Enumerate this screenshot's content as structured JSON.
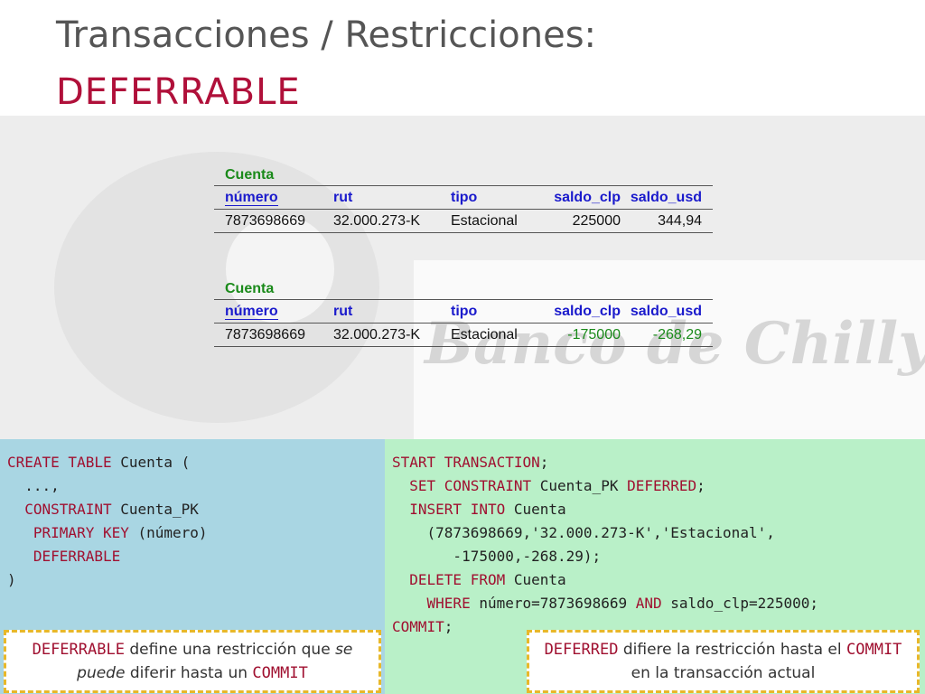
{
  "slide": {
    "title": "Transacciones / Restricciones:",
    "subtitle": "DEFERRABLE"
  },
  "photo": {
    "watermark": "Banco de Chilly"
  },
  "tables": [
    {
      "caption": "Cuenta",
      "headers": [
        "número",
        "rut",
        "tipo",
        "saldo_clp",
        "saldo_usd"
      ],
      "row": [
        "7873698669",
        "32.000.273-K",
        "Estacional",
        "225000",
        "344,94"
      ]
    },
    {
      "caption": "Cuenta",
      "headers": [
        "número",
        "rut",
        "tipo",
        "saldo_clp",
        "saldo_usd"
      ],
      "row": [
        "7873698669",
        "32.000.273-K",
        "Estacional",
        "-175000",
        "-268,29"
      ]
    }
  ],
  "code_left": {
    "l1_kw": "CREATE TABLE",
    "l1_txt": " Cuenta (",
    "l2_txt": "  ...,",
    "l3_kw": "  CONSTRAINT",
    "l3_txt": " Cuenta_PK",
    "l4_kw": "   PRIMARY KEY",
    "l4_txt": " (número)",
    "l5_kw": "   DEFERRABLE",
    "l6_txt": ")"
  },
  "code_right": {
    "l1_kw": "START TRANSACTION",
    "l1_txt": ";",
    "l2_kw": "  SET CONSTRAINT",
    "l2_txt": " Cuenta_PK ",
    "l2_kw2": "DEFERRED",
    "l2_txt2": ";",
    "l3_kw": "  INSERT INTO",
    "l3_txt": " Cuenta",
    "l4_txt": "    (7873698669,'32.000.273-K','Estacional',",
    "l5_txt": "       -175000,-268.29);",
    "l6_kw": "  DELETE FROM",
    "l6_txt": " Cuenta",
    "l7_kw": "    WHERE",
    "l7_txt": " número=7873698669 ",
    "l7_kw2": "AND",
    "l7_txt2": " saldo_clp=225000;",
    "l8_kw": "COMMIT",
    "l8_txt": ";"
  },
  "notes": {
    "left": {
      "kw": "DEFERRABLE",
      "t1": " define una restricción que ",
      "em": "se puede",
      "t2": " diferir hasta un ",
      "kw2": "COMMIT"
    },
    "right": {
      "kw": "DEFERRED",
      "t1": " difiere la restricción hasta el ",
      "kw2": "COMMIT",
      "t2": " en la transacción actual"
    }
  }
}
